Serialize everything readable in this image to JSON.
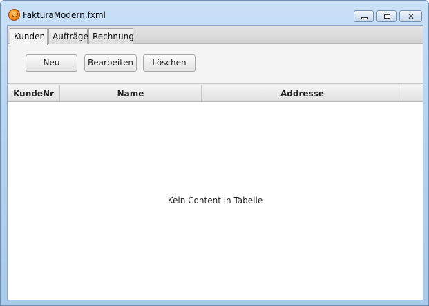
{
  "window": {
    "title": "FakturaModern.fxml"
  },
  "tabs": [
    {
      "label": "Kunden"
    },
    {
      "label": "Aufträge"
    },
    {
      "label": "Rechnung"
    }
  ],
  "active_tab": "Kunden",
  "toolbar": {
    "new_label": "Neu",
    "edit_label": "Bearbeiten",
    "delete_label": "Löschen"
  },
  "table": {
    "columns": [
      "KundeNr",
      "Name",
      "Addresse"
    ],
    "rows": [],
    "placeholder": "Kein Content in Tabelle"
  }
}
